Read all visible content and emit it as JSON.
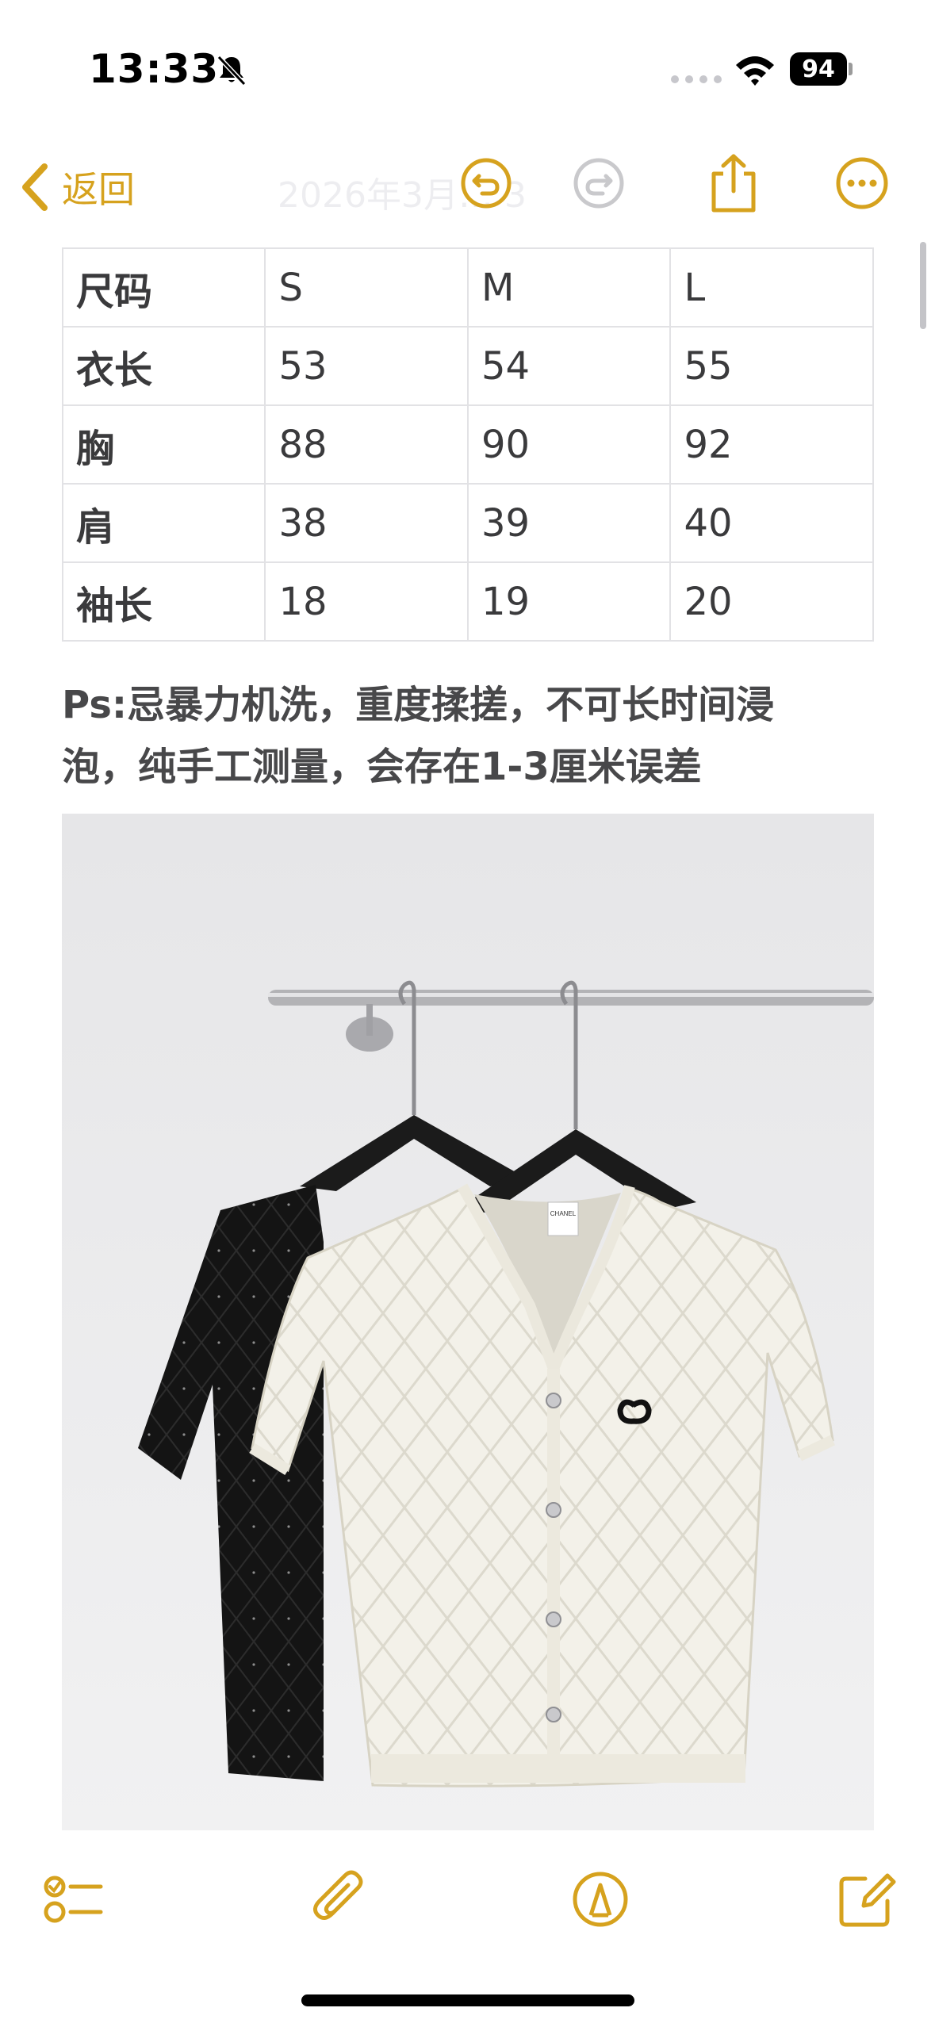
{
  "status": {
    "time": "13:33",
    "battery": "94",
    "accent": "#d6a21e"
  },
  "nav": {
    "back_label": "返回",
    "title": "2026年3月… 3",
    "icons": [
      "undo-icon",
      "redo-icon",
      "share-icon",
      "more-icon"
    ]
  },
  "size_table": {
    "headers": [
      "尺码",
      "S",
      "M",
      "L"
    ],
    "rows": [
      [
        "衣长",
        "53",
        "54",
        "55"
      ],
      [
        "胸",
        "88",
        "90",
        "92"
      ],
      [
        "肩",
        "38",
        "39",
        "40"
      ],
      [
        "袖长",
        "18",
        "19",
        "20"
      ]
    ]
  },
  "note": {
    "line1": "Ps:忌暴力机洗，重度揉搓，不可长时间浸",
    "line2": "泡，纯手工测量，会存在1-3厘米误差"
  },
  "photo": {
    "label_text": "CHANEL"
  },
  "toolbar": {
    "icons": [
      "checklist-icon",
      "attachment-icon",
      "markup-icon",
      "compose-icon"
    ]
  }
}
